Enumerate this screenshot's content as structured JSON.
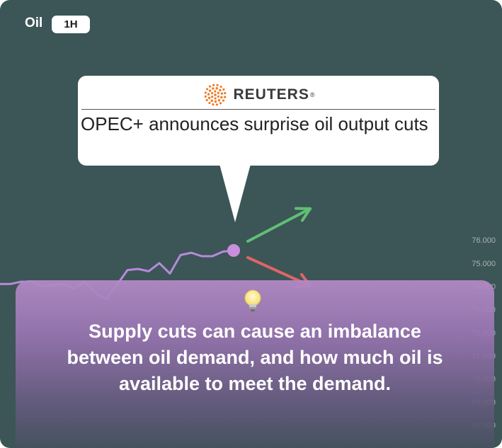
{
  "header": {
    "symbol": "Oil",
    "timeframe": "1H"
  },
  "news": {
    "source": "REUTERS",
    "source_mark": "®",
    "headline": "OPEC+ announces surprise oil output cuts"
  },
  "info": {
    "icon": "lightbulb-icon",
    "text": "Supply cuts can cause an imbalance between oil demand, and how much oil is available to meet the demand."
  },
  "colors": {
    "background": "#3c5557",
    "price_line": "#b78ad9",
    "marker": "#c98fdc",
    "arrow_up": "#5fbf74",
    "arrow_down": "#e06565",
    "reuters_orange": "#f07b23"
  },
  "chart_data": {
    "type": "line",
    "title": "",
    "xlabel": "",
    "ylabel": "",
    "y_ticks": [
      "76.000",
      "75.000",
      "74.000",
      "73.000",
      "72.000",
      "71.000",
      "70.000",
      "69.000",
      "68.000"
    ],
    "ylim": [
      67.4,
      77.2
    ],
    "series": [
      {
        "values": [
          74.1,
          74.1,
          74.2,
          74.2,
          74.0,
          74.05,
          74.1,
          73.9,
          74.2,
          73.7,
          73.45,
          74.05,
          74.7,
          74.75,
          74.65,
          75.0,
          74.55,
          75.35,
          75.45,
          75.3,
          75.3,
          75.5,
          75.55
        ]
      }
    ],
    "event_marker_index": 22,
    "projections": [
      "up",
      "down"
    ]
  }
}
